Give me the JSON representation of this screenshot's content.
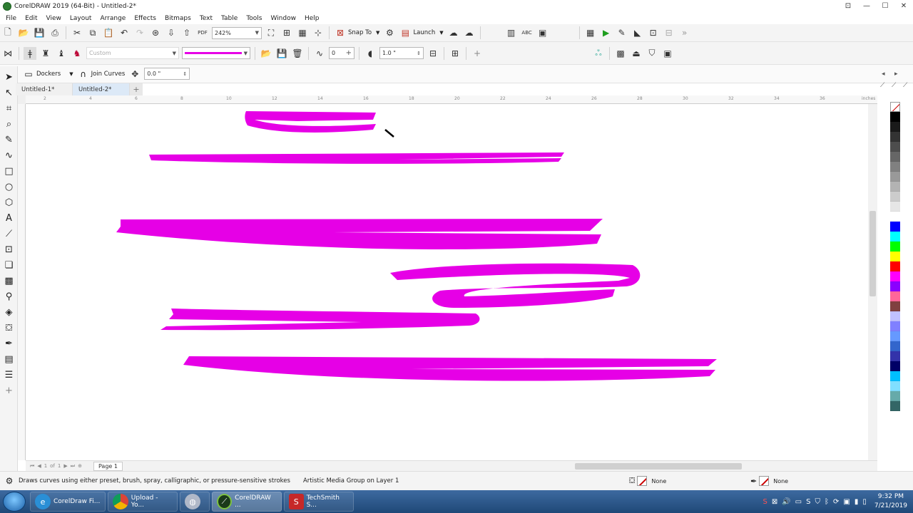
{
  "window": {
    "title": "CorelDRAW 2019 (64-Bit) - Untitled-2*"
  },
  "menu": [
    "File",
    "Edit",
    "View",
    "Layout",
    "Arrange",
    "Effects",
    "Bitmaps",
    "Text",
    "Table",
    "Tools",
    "Window",
    "Help"
  ],
  "toolbar1": {
    "zoom": "242%",
    "snap_to": "Snap To",
    "launch": "Launch"
  },
  "toolbar2": {
    "preset": "Custom",
    "smoothing": "0",
    "width": "1.0 \""
  },
  "toolbar3": {
    "dockers": "Dockers",
    "join_curves": "Join Curves",
    "angle": "0.0 \""
  },
  "doc_tabs": [
    "Untitled-1*",
    "Untitled-2*"
  ],
  "ruler": {
    "ticks": [
      "2",
      "4",
      "6",
      "8",
      "10",
      "12",
      "14",
      "16",
      "18",
      "20",
      "22",
      "24",
      "26",
      "28",
      "30",
      "32",
      "34",
      "36"
    ],
    "unit": "inches"
  },
  "page_nav": {
    "current": "1",
    "of": "of",
    "total": "1",
    "page_tab": "Page 1"
  },
  "status": {
    "hint": "Draws curves using either preset, brush, spray, calligraphic, or pressure-sensitive strokes",
    "object": "Artistic Media Group on Layer 1",
    "fill": "None",
    "outline": "None"
  },
  "colors": {
    "stroke": "#e600e6",
    "accent": "#1f4877"
  },
  "palette": [
    "#000000",
    "#1a1a1a",
    "#333333",
    "#4d4d4d",
    "#666666",
    "#808080",
    "#999999",
    "#b3b3b3",
    "#cccccc",
    "#e6e6e6",
    "#ffffff",
    "#0000ff",
    "#00ffff",
    "#00ff00",
    "#ffff00",
    "#ff0000",
    "#ff00ff",
    "#8b00ff",
    "#ff6699",
    "#804040",
    "#c0c0ff",
    "#8080ff",
    "#6699ff",
    "#3366cc",
    "#3333aa",
    "#000066",
    "#00bfff",
    "#80dfff",
    "#66aaaa",
    "#336666"
  ],
  "taskbar": {
    "items": [
      "CorelDraw Fi...",
      "Upload - Yo...",
      "",
      "CorelDRAW ...",
      "TechSmith S..."
    ],
    "time": "9:32 PM",
    "date": "7/21/2019"
  }
}
